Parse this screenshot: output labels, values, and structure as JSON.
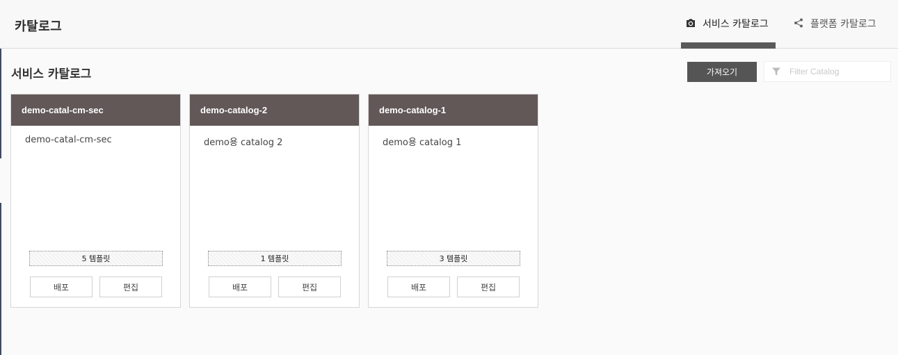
{
  "header": {
    "title": "카탈로그",
    "tabs": [
      {
        "label": "서비스 카탈로그",
        "icon": "camera-icon",
        "active": true
      },
      {
        "label": "플랫폼 카탈로그",
        "icon": "share-icon",
        "active": false
      }
    ]
  },
  "section": {
    "title": "서비스 카탈로그",
    "import_label": "가져오기",
    "filter_placeholder": "Filter Catalog"
  },
  "cards": [
    {
      "name": "demo-catal-cm-sec",
      "description": "demo-catal-cm-sec",
      "templates": "5 템플릿",
      "deploy_label": "배포",
      "edit_label": "편집"
    },
    {
      "name": "demo-catalog-2",
      "description": "demo용 catalog 2",
      "templates": "1 템플릿",
      "deploy_label": "배포",
      "edit_label": "편집"
    },
    {
      "name": "demo-catalog-1",
      "description": "demo용 catalog 1",
      "templates": "3 템플릿",
      "deploy_label": "배포",
      "edit_label": "편집"
    }
  ],
  "colors": {
    "card_header": "#625858",
    "active_tab_underline": "#5a5a5a",
    "import_button": "#555555"
  }
}
